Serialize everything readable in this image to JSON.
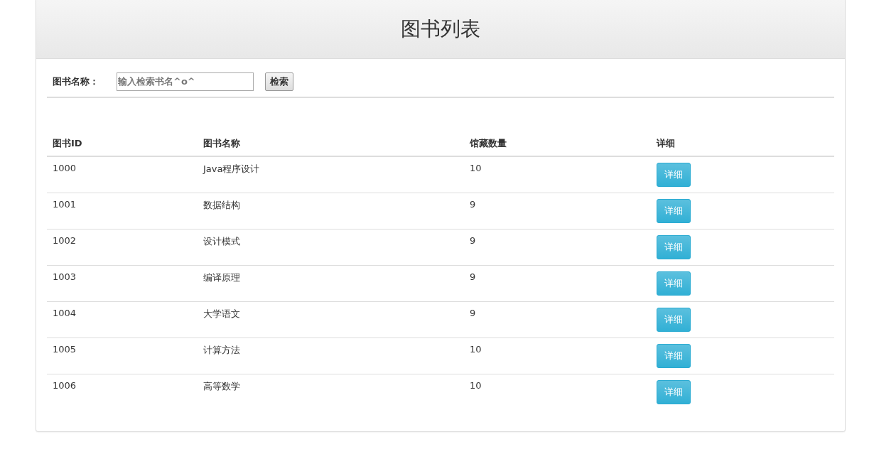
{
  "panel": {
    "title": "图书列表"
  },
  "search": {
    "label": "图书名称：",
    "placeholder": "输入检索书名^o^",
    "button": "检索"
  },
  "table": {
    "columns": [
      "图书ID",
      "图书名称",
      "馆藏数量",
      "详细"
    ],
    "rows": [
      {
        "id": "1000",
        "name": "Java程序设计",
        "count": "10",
        "action": "详细"
      },
      {
        "id": "1001",
        "name": "数据结构",
        "count": "9",
        "action": "详细"
      },
      {
        "id": "1002",
        "name": "设计模式",
        "count": "9",
        "action": "详细"
      },
      {
        "id": "1003",
        "name": "编译原理",
        "count": "9",
        "action": "详细"
      },
      {
        "id": "1004",
        "name": "大学语文",
        "count": "9",
        "action": "详细"
      },
      {
        "id": "1005",
        "name": "计算方法",
        "count": "10",
        "action": "详细"
      },
      {
        "id": "1006",
        "name": "高等数学",
        "count": "10",
        "action": "详细"
      }
    ]
  }
}
